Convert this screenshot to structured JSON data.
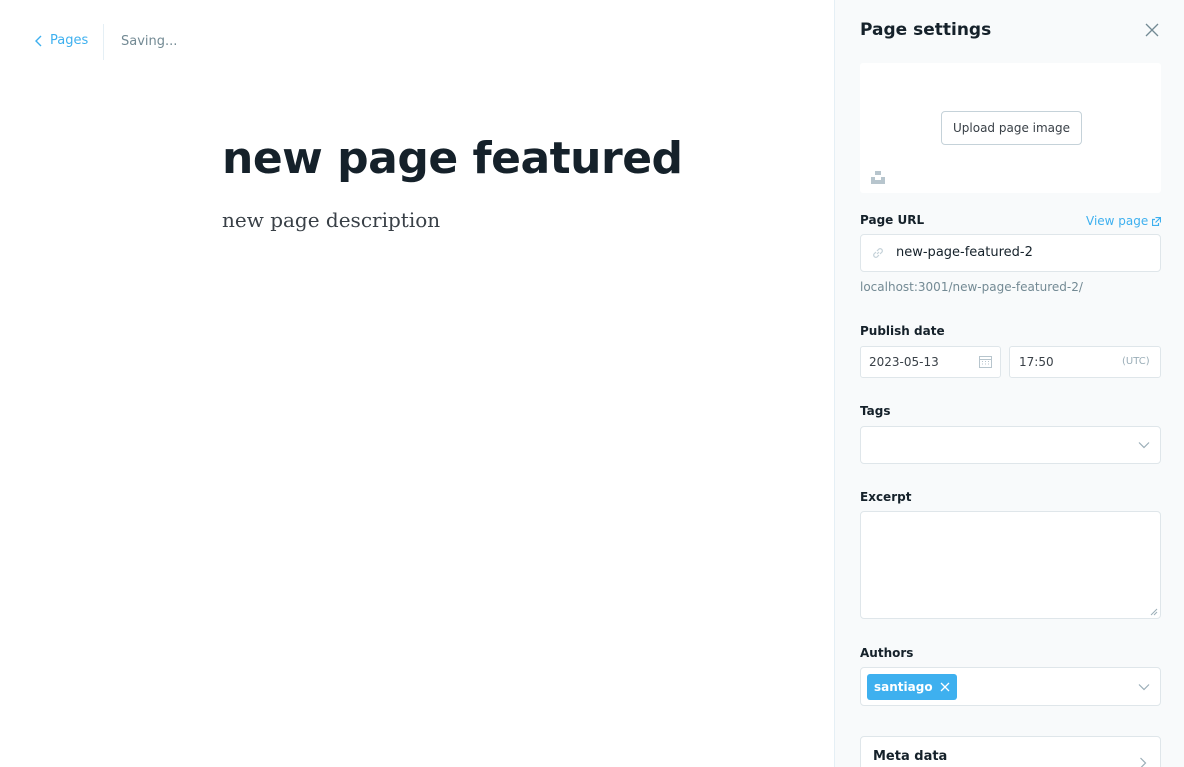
{
  "topbar": {
    "back_label": "Pages",
    "status": "Saving..."
  },
  "editor": {
    "title": "new page featured",
    "description": "new page description"
  },
  "settings": {
    "header": "Page settings",
    "upload_label": "Upload page image",
    "url_label": "Page URL",
    "view_page_label": "View page",
    "url_value": "new-page-featured-2",
    "url_hint": "localhost:3001/new-page-featured-2/",
    "publish_label": "Publish date",
    "date_value": "2023-05-13",
    "time_value": "17:50",
    "timezone": "(UTC)",
    "tags_label": "Tags",
    "excerpt_label": "Excerpt",
    "authors_label": "Authors",
    "authors": [
      "santiago"
    ],
    "meta_label": "Meta data"
  },
  "colors": {
    "accent": "#3eb0ef",
    "text": "#15212a",
    "muted": "#738a94",
    "border": "#dfe6ea",
    "panel_bg": "#f8fafb"
  },
  "icons": {
    "back": "chevron-left-icon",
    "close": "close-icon",
    "unsplash": "unsplash-icon",
    "link": "link-icon",
    "external": "external-link-icon",
    "calendar": "calendar-icon",
    "dropdown": "chevron-down-icon",
    "remove": "remove-icon",
    "arrow": "chevron-right-icon"
  }
}
